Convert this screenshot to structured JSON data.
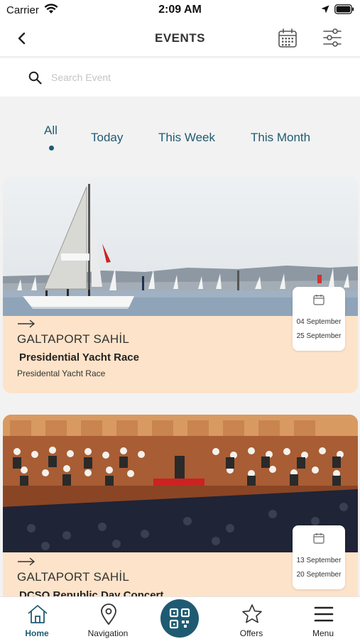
{
  "status_bar": {
    "carrier": "Carrier",
    "time": "2:09 AM"
  },
  "header": {
    "title": "EVENTS"
  },
  "search": {
    "placeholder": "Search Event",
    "value": ""
  },
  "tabs": [
    {
      "label": "All",
      "active": true
    },
    {
      "label": "Today",
      "active": false
    },
    {
      "label": "This Week",
      "active": false
    },
    {
      "label": "This Month",
      "active": false
    }
  ],
  "events": [
    {
      "venue": "GALTAPORT SAHİL",
      "title": "Presidential Yacht Race",
      "subtitle": "Presidental Yacht Race",
      "start_date": "04 September",
      "end_date": "25 September"
    },
    {
      "venue": "GALTAPORT SAHİL",
      "title": "DCSO Republic Day Concert",
      "subtitle": "",
      "start_date": "13 September",
      "end_date": "20 September"
    }
  ],
  "bottom_nav": [
    {
      "label": "Home",
      "icon": "home-icon",
      "active": true
    },
    {
      "label": "Navigation",
      "icon": "map-pin-icon",
      "active": false
    },
    {
      "label": "",
      "icon": "qr-code-icon",
      "active": false
    },
    {
      "label": "Offers",
      "icon": "star-icon",
      "active": false
    },
    {
      "label": "Menu",
      "icon": "menu-icon",
      "active": false
    }
  ],
  "colors": {
    "accent": "#1e5b73",
    "card_background": "#fde3c9",
    "page_background": "#f2f2f2"
  }
}
